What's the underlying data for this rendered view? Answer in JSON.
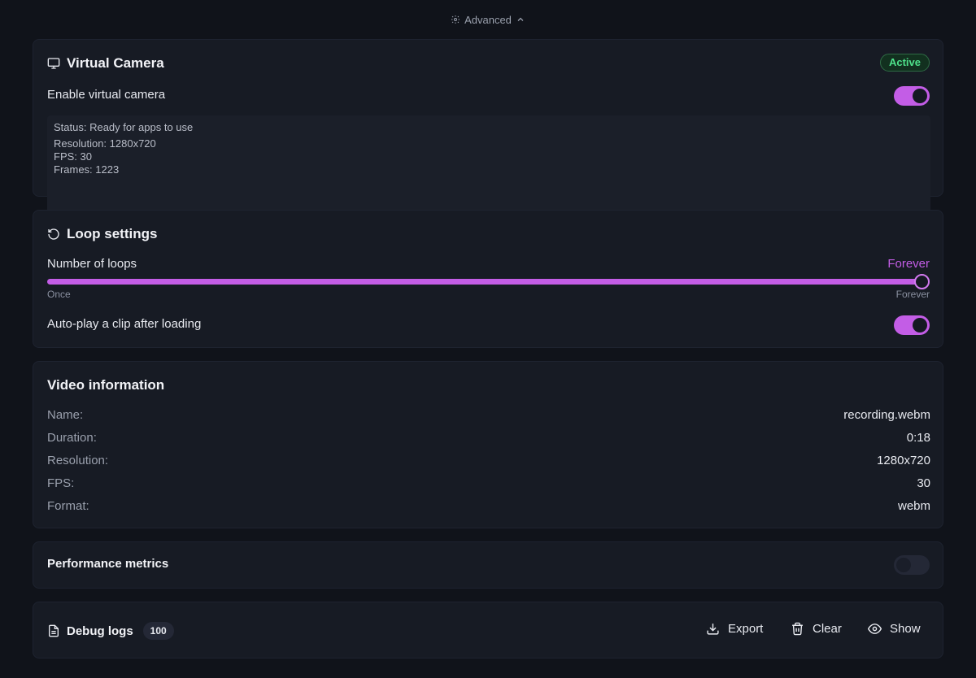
{
  "advanced": {
    "label": "Advanced"
  },
  "virtual_camera": {
    "title": "Virtual Camera",
    "badge": "Active",
    "enable_label": "Enable virtual camera",
    "enabled": true,
    "status": {
      "status_line": "Status: Ready for apps to use",
      "resolution_line": "Resolution: 1280x720",
      "fps_line": "FPS: 30",
      "frames_line": "Frames: 1223"
    }
  },
  "loop_settings": {
    "title": "Loop settings",
    "loops_label": "Number of loops",
    "loops_value": "Forever",
    "slider_value_fraction": 1.0,
    "min_label": "Once",
    "max_label": "Forever",
    "autoplay_label": "Auto-play a clip after loading",
    "autoplay_enabled": true
  },
  "video_info": {
    "title": "Video information",
    "rows": [
      {
        "key": "Name:",
        "value": "recording.webm"
      },
      {
        "key": "Duration:",
        "value": "0:18"
      },
      {
        "key": "Resolution:",
        "value": "1280x720"
      },
      {
        "key": "FPS:",
        "value": "30"
      },
      {
        "key": "Format:",
        "value": "webm"
      }
    ]
  },
  "performance": {
    "title": "Performance metrics",
    "enabled": false
  },
  "debug_logs": {
    "title": "Debug logs",
    "count": "100",
    "actions": {
      "export": "Export",
      "clear": "Clear",
      "show": "Show"
    }
  },
  "colors": {
    "accent": "#c35de6",
    "active_green": "#4ee08a",
    "background": "#10131a",
    "card": "#171b24"
  }
}
